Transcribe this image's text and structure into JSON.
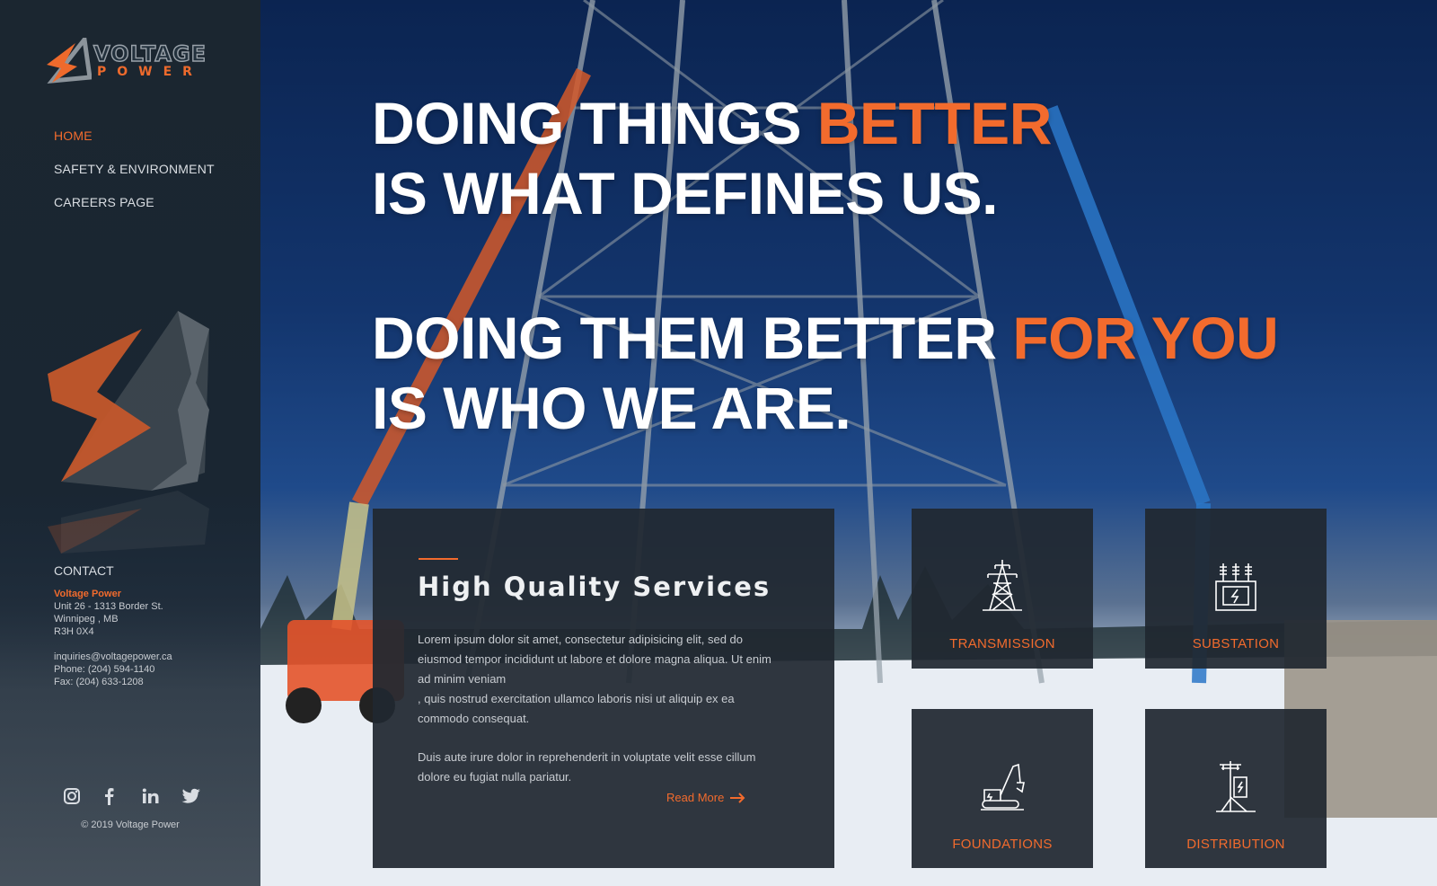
{
  "brand": {
    "logo_line1": "VOLTAGE",
    "logo_line2": "POWER"
  },
  "nav": {
    "items": [
      {
        "label": "HOME",
        "active": true
      },
      {
        "label": "SAFETY & ENVIRONMENT",
        "active": false
      },
      {
        "label": "CAREERS PAGE",
        "active": false
      }
    ]
  },
  "contact": {
    "heading": "CONTACT",
    "company": "Voltage Power",
    "address1": "Unit 26 - 1313 Border St.",
    "address2": "Winnipeg , MB",
    "postal": "R3H 0X4",
    "email": "inquiries@voltagepower.ca",
    "phone": "Phone: (204) 594-1140",
    "fax": "Fax: (204) 633-1208"
  },
  "social": [
    "instagram-icon",
    "facebook-icon",
    "linkedin-icon",
    "twitter-icon"
  ],
  "copyright": "© 2019 Voltage Power",
  "headline1": {
    "line1_white": "DOING THINGS ",
    "line1_accent": "BETTER",
    "line2": "IS WHAT DEFINES US."
  },
  "headline2": {
    "line1_white": "DOING THEM BETTER ",
    "line1_accent": "FOR YOU",
    "line2": "IS WHO WE ARE."
  },
  "services": {
    "title": "High Quality Services",
    "paragraph1_a": "Lorem ipsum dolor sit amet, consectetur adipisicing elit, sed do eiusmod tempor incididunt ut labore et dolore magna aliqua. Ut enim ad minim veniam",
    "paragraph1_b": ", quis nostrud exercitation ullamco laboris nisi ut aliquip ex ea commodo consequat.",
    "paragraph2": "Duis aute irure dolor in reprehenderit in voluptate velit esse cillum dolore eu fugiat nulla pariatur.",
    "read_more": "Read More"
  },
  "tiles": [
    {
      "label": "TRANSMISSION",
      "icon": "transmission-tower-icon"
    },
    {
      "label": "SUBSTATION",
      "icon": "substation-icon"
    },
    {
      "label": "FOUNDATIONS",
      "icon": "excavator-icon"
    },
    {
      "label": "DISTRIBUTION",
      "icon": "distribution-pole-icon"
    }
  ],
  "colors": {
    "accent": "#f26b2d",
    "sidebar": "#1b2630",
    "panel": "#202830"
  }
}
